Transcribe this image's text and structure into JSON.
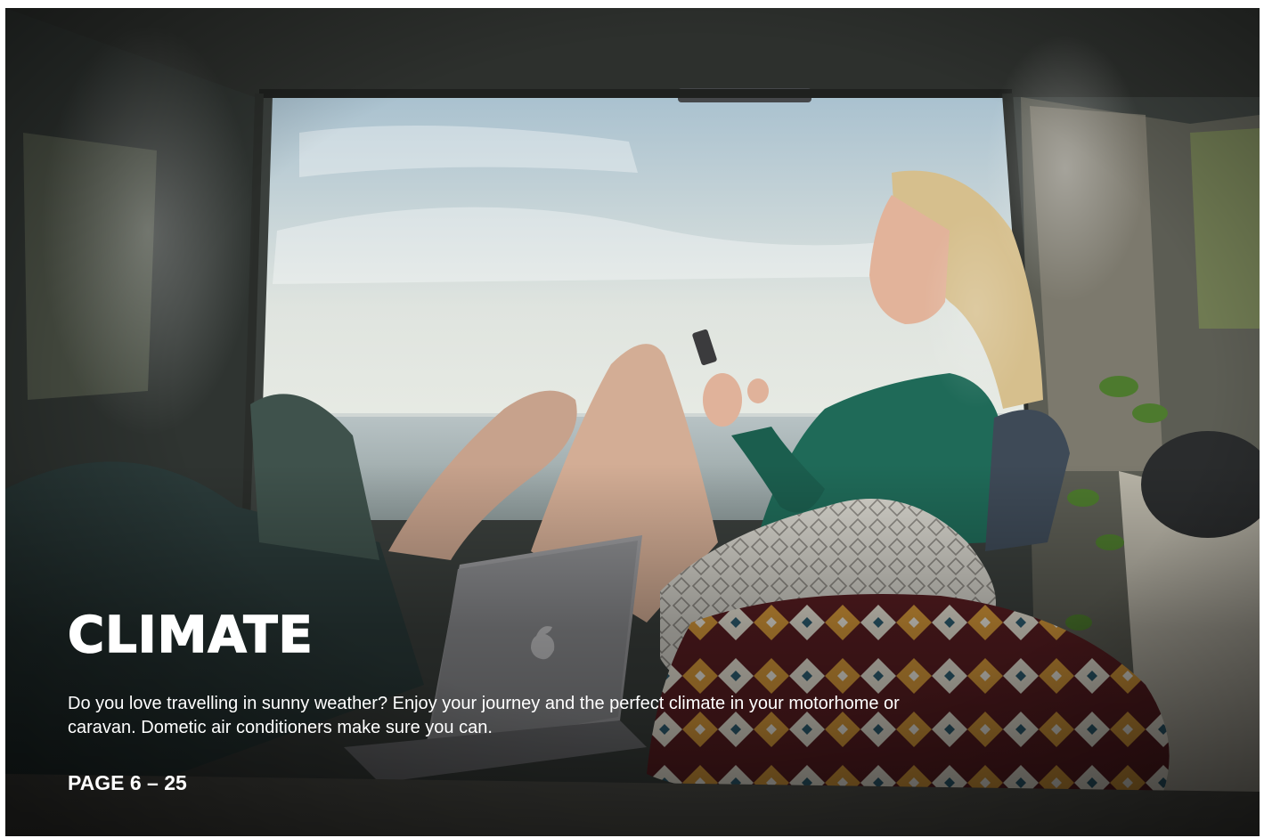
{
  "section": {
    "title": "CLIMATE",
    "description": "Do you love travelling in sunny weather? Enjoy your journey and the perfect climate in your motorhome or caravan. Dometic air conditioners make sure you can.",
    "page_range": "PAGE 6 – 25"
  },
  "photo": {
    "subject": "woman sitting at open rear door of a van looking out at the sea, holding a phone, laptop and cushions in front"
  }
}
